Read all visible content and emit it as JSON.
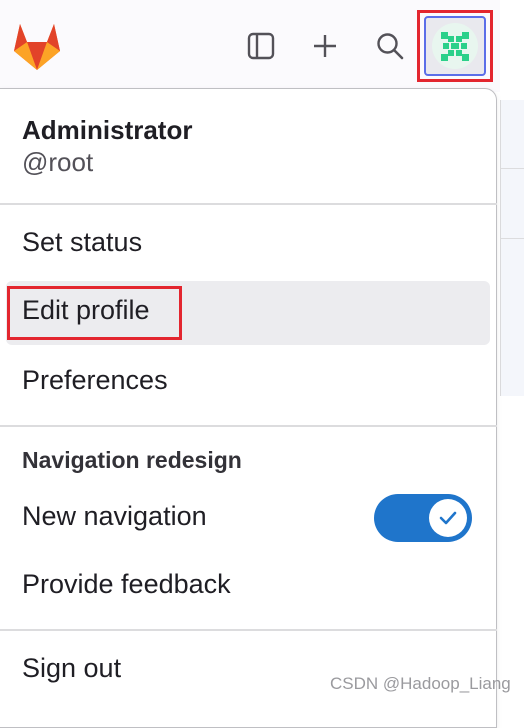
{
  "topbar": {
    "logo_icon": "gitlab-tanuki-icon",
    "sidebar_toggle_icon": "sidebar-toggle-icon",
    "new_icon": "plus-icon",
    "search_icon": "search-icon",
    "avatar_icon": "identicon-avatar"
  },
  "user": {
    "name": "Administrator",
    "username": "@root"
  },
  "menu": {
    "set_status": "Set status",
    "edit_profile": "Edit profile",
    "preferences": "Preferences",
    "section_title": "Navigation redesign",
    "new_navigation": "New navigation",
    "new_navigation_enabled": true,
    "provide_feedback": "Provide feedback",
    "sign_out": "Sign out"
  },
  "watermark": "CSDN @Hadoop_Liang",
  "colors": {
    "accent_blue": "#1f75cb",
    "highlight_red": "#e3262f",
    "gitlab_orange": "#e24329"
  }
}
